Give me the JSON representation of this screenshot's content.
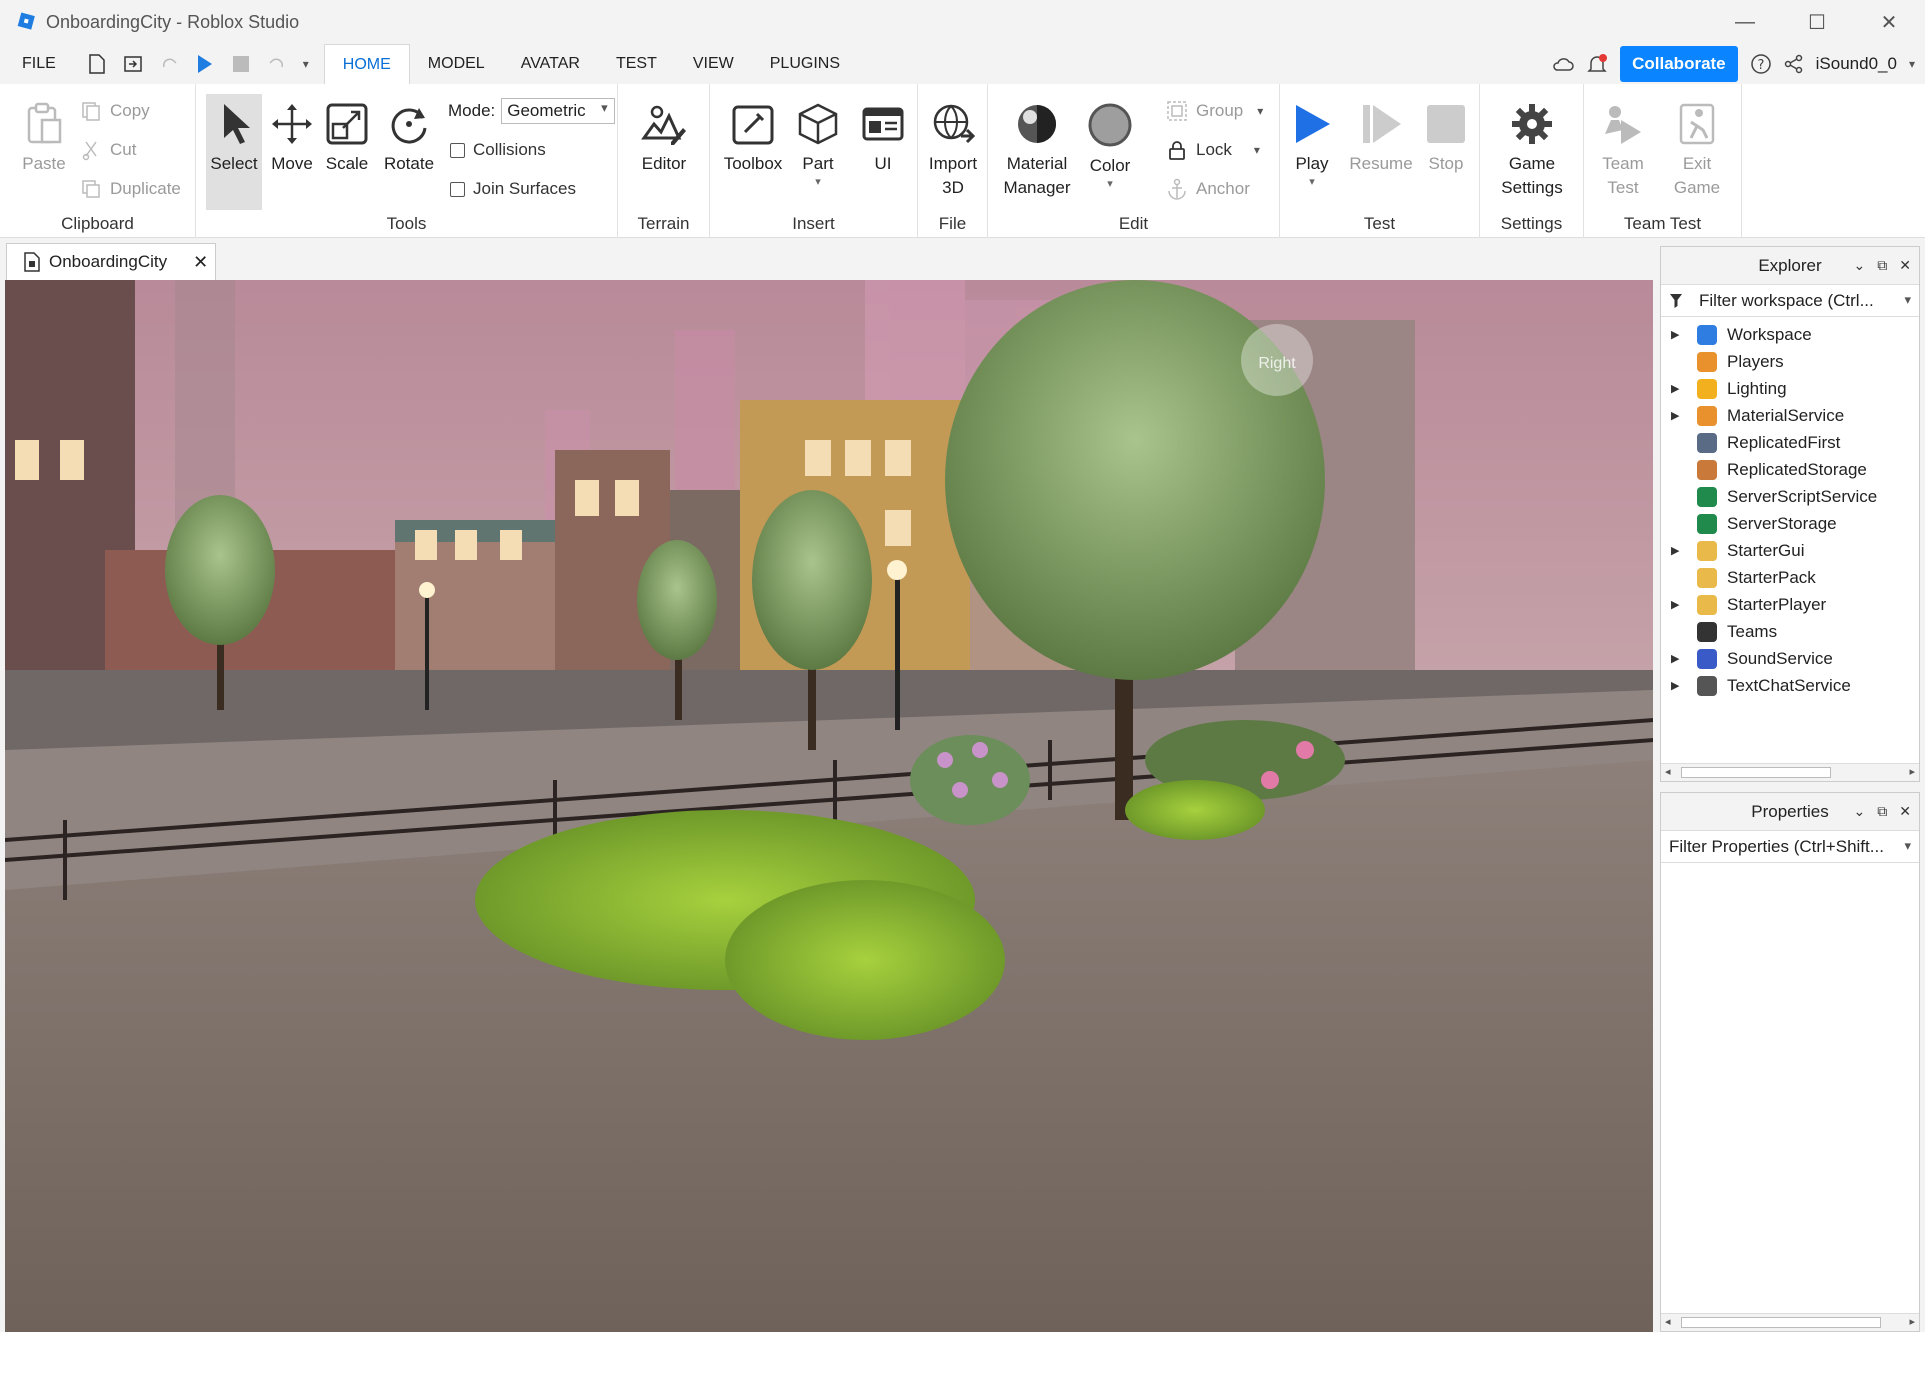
{
  "window": {
    "title": "OnboardingCity - Roblox Studio"
  },
  "menubar": {
    "file": "FILE",
    "tabs": [
      "HOME",
      "MODEL",
      "AVATAR",
      "TEST",
      "VIEW",
      "PLUGINS"
    ],
    "active_tab": "HOME",
    "collaborate": "Collaborate",
    "user": "iSound0_0"
  },
  "ribbon": {
    "clipboard": {
      "label": "Clipboard",
      "paste": "Paste",
      "copy": "Copy",
      "cut": "Cut",
      "duplicate": "Duplicate"
    },
    "tools": {
      "label": "Tools",
      "select": "Select",
      "move": "Move",
      "scale": "Scale",
      "rotate": "Rotate",
      "mode_label": "Mode:",
      "mode_value": "Geometric",
      "collisions": "Collisions",
      "join_surfaces": "Join Surfaces"
    },
    "terrain": {
      "label": "Terrain",
      "editor": "Editor"
    },
    "insert": {
      "label": "Insert",
      "toolbox": "Toolbox",
      "part": "Part",
      "ui": "UI"
    },
    "file": {
      "label": "File",
      "import_line1": "Import",
      "import_line2": "3D"
    },
    "edit": {
      "label": "Edit",
      "material_line1": "Material",
      "material_line2": "Manager",
      "color": "Color",
      "group": "Group",
      "lock": "Lock",
      "anchor": "Anchor"
    },
    "test": {
      "label": "Test",
      "play": "Play",
      "resume": "Resume",
      "stop": "Stop"
    },
    "settings": {
      "label": "Settings",
      "game_line1": "Game",
      "game_line2": "Settings"
    },
    "team_test": {
      "label": "Team Test",
      "team_line1": "Team",
      "team_line2": "Test",
      "exit_line1": "Exit",
      "exit_line2": "Game"
    }
  },
  "doc_tab": {
    "name": "OnboardingCity"
  },
  "viewport": {
    "view_cube_label": "Right"
  },
  "explorer": {
    "title": "Explorer",
    "filter": "Filter workspace (Ctrl...",
    "items": [
      {
        "name": "Workspace",
        "expandable": true,
        "color": "#2f7de1"
      },
      {
        "name": "Players",
        "expandable": false,
        "color": "#e8912d"
      },
      {
        "name": "Lighting",
        "expandable": true,
        "color": "#f2b01e"
      },
      {
        "name": "MaterialService",
        "expandable": true,
        "color": "#e8912d"
      },
      {
        "name": "ReplicatedFirst",
        "expandable": false,
        "color": "#5a6b86"
      },
      {
        "name": "ReplicatedStorage",
        "expandable": false,
        "color": "#c97a3a"
      },
      {
        "name": "ServerScriptService",
        "expandable": false,
        "color": "#1f8a4c"
      },
      {
        "name": "ServerStorage",
        "expandable": false,
        "color": "#1f8a4c"
      },
      {
        "name": "StarterGui",
        "expandable": true,
        "color": "#e9b949"
      },
      {
        "name": "StarterPack",
        "expandable": false,
        "color": "#e9b949"
      },
      {
        "name": "StarterPlayer",
        "expandable": true,
        "color": "#e9b949"
      },
      {
        "name": "Teams",
        "expandable": false,
        "color": "#333333"
      },
      {
        "name": "SoundService",
        "expandable": true,
        "color": "#3a5bc7"
      },
      {
        "name": "TextChatService",
        "expandable": true,
        "color": "#555555"
      }
    ]
  },
  "properties": {
    "title": "Properties",
    "filter": "Filter Properties (Ctrl+Shift..."
  }
}
